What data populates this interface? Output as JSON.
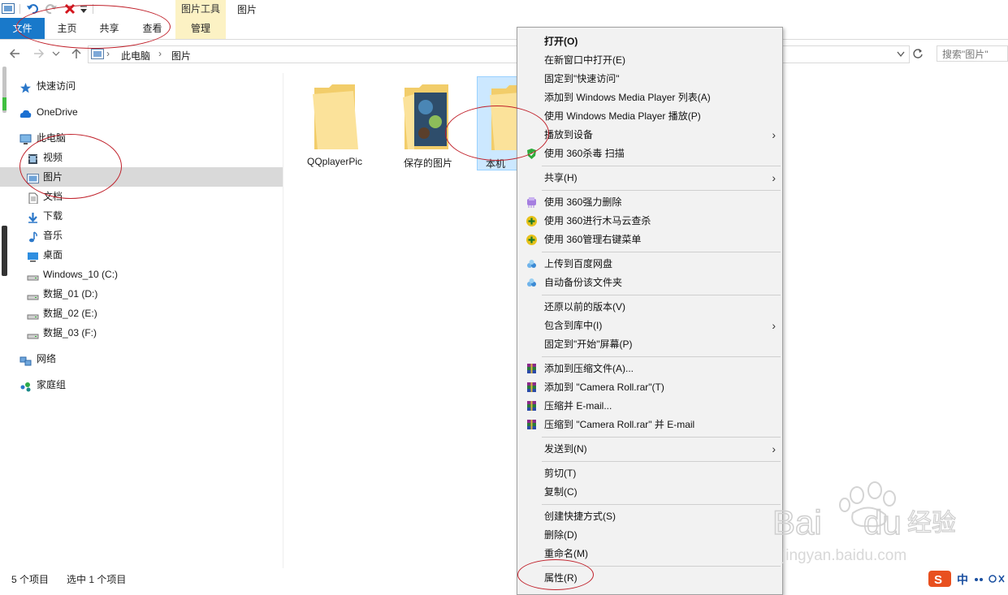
{
  "ribbon": {
    "context_group": "图片工具",
    "window_title": "图片",
    "tabs": [
      "文件",
      "主页",
      "共享",
      "查看",
      "管理"
    ]
  },
  "address": {
    "path": [
      "此电脑",
      "图片"
    ],
    "search_placeholder": "搜索\"图片\""
  },
  "nav": {
    "items": [
      {
        "label": "快速访问",
        "icon": "star-icon"
      },
      {
        "label": "OneDrive",
        "icon": "cloud-icon"
      },
      {
        "label": "此电脑",
        "icon": "computer-icon"
      },
      {
        "label": "视频",
        "icon": "video-icon"
      },
      {
        "label": "图片",
        "icon": "pictures-icon",
        "selected": true
      },
      {
        "label": "文档",
        "icon": "document-icon"
      },
      {
        "label": "下载",
        "icon": "download-icon"
      },
      {
        "label": "音乐",
        "icon": "music-icon"
      },
      {
        "label": "桌面",
        "icon": "desktop-icon"
      },
      {
        "label": "Windows_10 (C:)",
        "icon": "drive-icon"
      },
      {
        "label": "数据_01 (D:)",
        "icon": "drive-icon"
      },
      {
        "label": "数据_02 (E:)",
        "icon": "drive-icon"
      },
      {
        "label": "数据_03 (F:)",
        "icon": "drive-icon"
      },
      {
        "label": "网络",
        "icon": "network-icon"
      },
      {
        "label": "家庭组",
        "icon": "homegroup-icon"
      }
    ]
  },
  "content": {
    "items": [
      {
        "label": "QQplayerPic",
        "icon": "folder-icon"
      },
      {
        "label": "保存的图片",
        "icon": "folder-with-photo-icon"
      },
      {
        "label": "本机",
        "icon": "folder-icon",
        "selected": true
      }
    ]
  },
  "status": {
    "count": "5 个项目",
    "selected": "选中 1 个项目"
  },
  "context_menu": {
    "items": [
      {
        "label": "打开(O)",
        "bold": true
      },
      {
        "label": "在新窗口中打开(E)"
      },
      {
        "label": "固定到\"快速访问\""
      },
      {
        "label": "添加到 Windows Media Player 列表(A)"
      },
      {
        "label": "使用 Windows Media Player 播放(P)"
      },
      {
        "label": "播放到设备",
        "submenu": true
      },
      {
        "label": "使用 360杀毒 扫描",
        "icon": "shield-360-icon"
      },
      {
        "sep": true
      },
      {
        "label": "共享(H)",
        "submenu": true
      },
      {
        "sep": true
      },
      {
        "label": "使用 360强力删除",
        "icon": "shred-360-icon"
      },
      {
        "label": "使用 360进行木马云查杀",
        "icon": "trojan-360-icon"
      },
      {
        "label": "使用 360管理右键菜单",
        "icon": "menu-360-icon"
      },
      {
        "sep": true
      },
      {
        "label": "上传到百度网盘",
        "icon": "baidu-cloud-icon"
      },
      {
        "label": "自动备份该文件夹",
        "icon": "baidu-backup-icon"
      },
      {
        "sep": true
      },
      {
        "label": "还原以前的版本(V)"
      },
      {
        "label": "包含到库中(I)",
        "submenu": true
      },
      {
        "label": "固定到\"开始\"屏幕(P)"
      },
      {
        "sep": true
      },
      {
        "label": "添加到压缩文件(A)...",
        "icon": "winrar-icon"
      },
      {
        "label": "添加到 \"Camera Roll.rar\"(T)",
        "icon": "winrar-icon"
      },
      {
        "label": "压缩并 E-mail...",
        "icon": "winrar-icon"
      },
      {
        "label": "压缩到 \"Camera Roll.rar\" 并 E-mail",
        "icon": "winrar-icon"
      },
      {
        "sep": true
      },
      {
        "label": "发送到(N)",
        "submenu": true
      },
      {
        "sep": true
      },
      {
        "label": "剪切(T)"
      },
      {
        "label": "复制(C)"
      },
      {
        "sep": true
      },
      {
        "label": "创建快捷方式(S)"
      },
      {
        "label": "删除(D)"
      },
      {
        "label": "重命名(M)"
      },
      {
        "sep": true
      },
      {
        "label": "属性(R)"
      }
    ]
  },
  "tray": {
    "ime": "中"
  }
}
